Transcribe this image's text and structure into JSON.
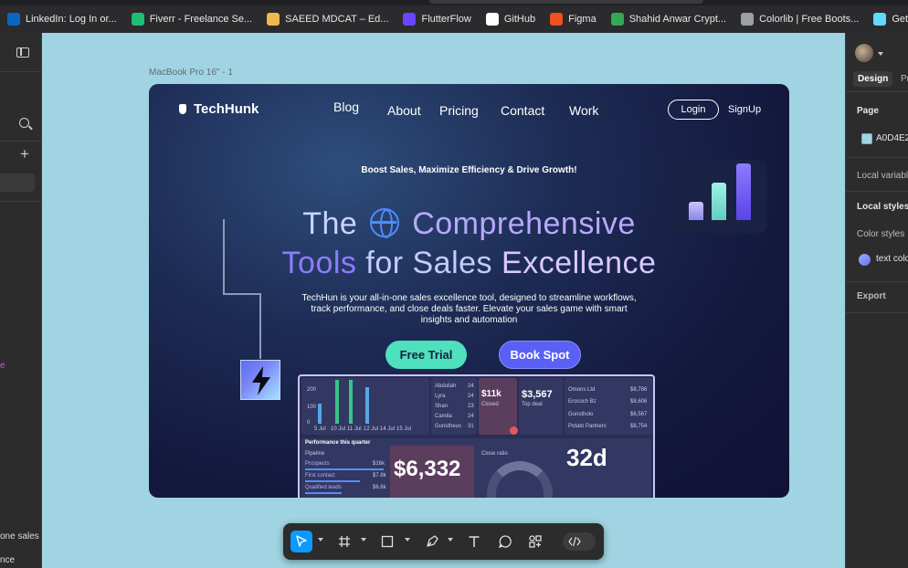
{
  "bookmarks": [
    {
      "label": "LinkedIn: Log In or...",
      "icon": "linkedin-icon",
      "color": "#0a66c2"
    },
    {
      "label": "Fiverr - Freelance Se...",
      "icon": "fiverr-icon",
      "color": "#1dbf73"
    },
    {
      "label": "SAEED MDCAT – Ed...",
      "icon": "saeed-mdcat-icon",
      "color": "#f2b84b"
    },
    {
      "label": "FlutterFlow",
      "icon": "flutterflow-icon",
      "color": "#6a45ff"
    },
    {
      "label": "GitHub",
      "icon": "github-icon",
      "color": "#ffffff"
    },
    {
      "label": "Figma",
      "icon": "figma-icon",
      "color": "#f24e1e"
    },
    {
      "label": "Shahid Anwar Crypt...",
      "icon": "drive-icon",
      "color": "#34a853"
    },
    {
      "label": "Colorlib | Free Boots...",
      "icon": "globe-icon",
      "color": "#9aa0a6"
    },
    {
      "label": "Getting Started – Re...",
      "icon": "react-icon",
      "color": "#61dafb"
    }
  ],
  "left_sidebar": {
    "cut_text_1": "e",
    "cut_text_2": "one sales e",
    "cut_text_3": "nce"
  },
  "canvas": {
    "background": "#a0d4e2",
    "frame_label": "MacBook Pro 16\" - 1"
  },
  "site": {
    "logo": "TechHunk",
    "nav": [
      "Blog",
      "About",
      "Pricing",
      "Contact",
      "Work"
    ],
    "login": "Login",
    "signup": "SignUp",
    "tagline": "Boost Sales, Maximize Efficiency & Drive Growth!",
    "heading_line1_a": "The",
    "heading_line1_b": "Comprehensive",
    "heading_line2_a": "Tools",
    "heading_line2_b": "for Sales",
    "heading_line2_c": "Excellence",
    "description": "TechHun is your all-in-one sales excellence tool, designed to streamline workflows, track performance, and close deals faster. Elevate your sales game with smart insights and automation",
    "cta_primary": "Free Trial",
    "cta_secondary": "Book Spot",
    "colors": {
      "primary_cta": "#4fe0bd",
      "secondary_cta": "#5a5ff5",
      "globe": "#4d8cff"
    },
    "hero_chart_bars": [
      0.3,
      0.6,
      0.9
    ],
    "dashboard": {
      "axis_labels": [
        "200",
        "100",
        "0"
      ],
      "x_labels": [
        "5 Jul",
        "10 Jul",
        "11 Jul",
        "12 Jul",
        "14 Jul",
        "15 Jul"
      ],
      "leaderboard": [
        {
          "name": "Abdullah",
          "value": "24"
        },
        {
          "name": "Lyra",
          "value": "24"
        },
        {
          "name": "Shan",
          "value": "23"
        },
        {
          "name": "Camila",
          "value": "24"
        },
        {
          "name": "Gunstheus",
          "value": "31"
        }
      ],
      "kpi_1": "$11k",
      "kpi_1_label": "Closed",
      "kpi_2": "$3,567",
      "kpi_2_label": "Top deal",
      "accounts": [
        {
          "name": "Omons Ltd",
          "value": "$8,786"
        },
        {
          "name": "Erococh Bz",
          "value": "$8,606"
        },
        {
          "name": "Gunstholo",
          "value": "$6,567"
        },
        {
          "name": "Potato Partners",
          "value": "$8,754"
        }
      ],
      "quarter_title": "Performance this quarter",
      "pipeline_title": "Pipeline",
      "pipeline": [
        {
          "name": "Prospects",
          "value": "$16k"
        },
        {
          "name": "First contact",
          "value": "$7.8k"
        },
        {
          "name": "Qualified leads",
          "value": "$6.6k"
        }
      ],
      "big_value": "$6,332",
      "close_ratio_label": "Close ratio",
      "days_value": "32d"
    }
  },
  "toolbar": {
    "tools": [
      "move-tool",
      "frame-tool",
      "shape-tool",
      "pen-tool",
      "text-tool",
      "comment-tool",
      "actions-tool",
      "dev-mode-toggle"
    ]
  },
  "right_sidebar": {
    "tab_design": "Design",
    "tab_prototype": "Pr",
    "page_heading": "Page",
    "page_color_hex": "A0D4E2",
    "local_variables": "Local variabl",
    "local_styles": "Local styles",
    "color_styles": "Color styles",
    "style_name": "text colo",
    "export": "Export"
  }
}
